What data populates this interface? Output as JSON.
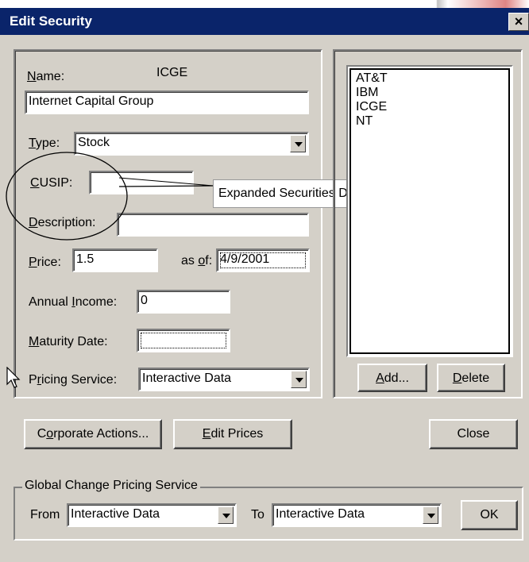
{
  "window": {
    "title": "Edit Security",
    "close_glyph": "×"
  },
  "form": {
    "name_label": "Name:",
    "name_symbol": "ICGE",
    "name_value": "Internet Capital Group",
    "type_label": "Type:",
    "type_value": "Stock",
    "cusip_label": "CUSIP:",
    "cusip_value": "",
    "description_label": "Description:",
    "description_value": "",
    "price_label": "Price:",
    "price_value": "1.5",
    "as_of_label": "as of:",
    "as_of_value": "4/9/2001",
    "annual_income_label": "Annual Income:",
    "annual_income_value": "0",
    "maturity_date_label": "Maturity Date:",
    "maturity_date_value": "",
    "pricing_service_label": "Pricing Service:",
    "pricing_service_value": "Interactive Data"
  },
  "callout": {
    "text": "Expanded Securities Descriptions"
  },
  "securities_list": {
    "items": [
      "AT&T",
      "IBM",
      "ICGE",
      "NT"
    ],
    "add_label": "Add...",
    "delete_label": "Delete"
  },
  "actions": {
    "corporate_actions_label": "Corporate Actions...",
    "edit_prices_label": "Edit Prices",
    "close_label": "Close"
  },
  "global_change": {
    "title": "Global Change Pricing Service",
    "from_label": "From",
    "from_value": "Interactive Data",
    "to_label": "To",
    "to_value": "Interactive Data",
    "ok_label": "OK"
  }
}
